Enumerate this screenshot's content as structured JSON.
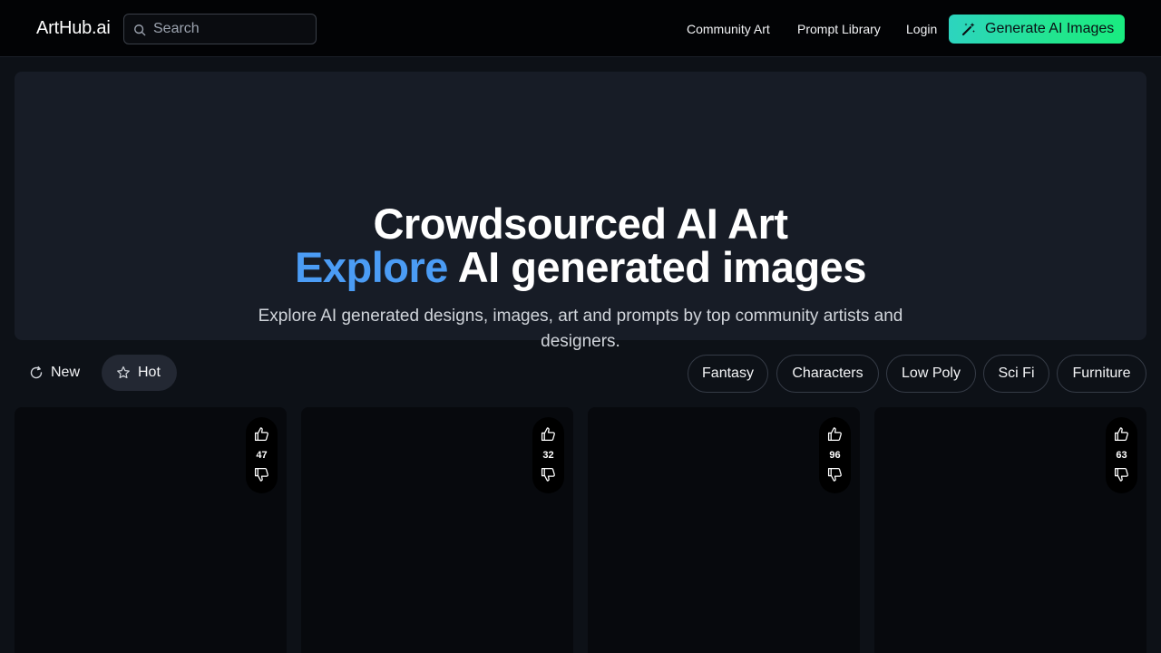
{
  "header": {
    "brand": "ArtHub.ai",
    "search_placeholder": "Search",
    "nav": [
      "Community Art",
      "Prompt Library",
      "Login"
    ],
    "cta_label": "Generate AI Images"
  },
  "hero": {
    "title_line1": "Crowdsourced AI Art",
    "title_line2_accent": "Explore",
    "title_line2_rest": " AI generated images",
    "subtitle": "Explore AI generated designs, images, art and prompts by top community artists and designers."
  },
  "sort": {
    "new_label": "New",
    "hot_label": "Hot",
    "active": "Hot"
  },
  "categories": [
    "Fantasy",
    "Characters",
    "Low Poly",
    "Sci Fi",
    "Furniture"
  ],
  "cards": [
    {
      "votes": "47"
    },
    {
      "votes": "32"
    },
    {
      "votes": "96"
    },
    {
      "votes": "63"
    }
  ],
  "colors": {
    "accent": "#4b9cf5",
    "cta_gradient_start": "#2dd4bf",
    "cta_gradient_end": "#19ec80",
    "background": "#0d1117",
    "hero_background": "#171c26"
  },
  "icons": {
    "search": "search-icon",
    "cta": "magic-wand-icon",
    "new": "refresh-icon",
    "hot": "star-icon",
    "upvote": "thumbs-up-icon",
    "downvote": "thumbs-down-icon"
  }
}
